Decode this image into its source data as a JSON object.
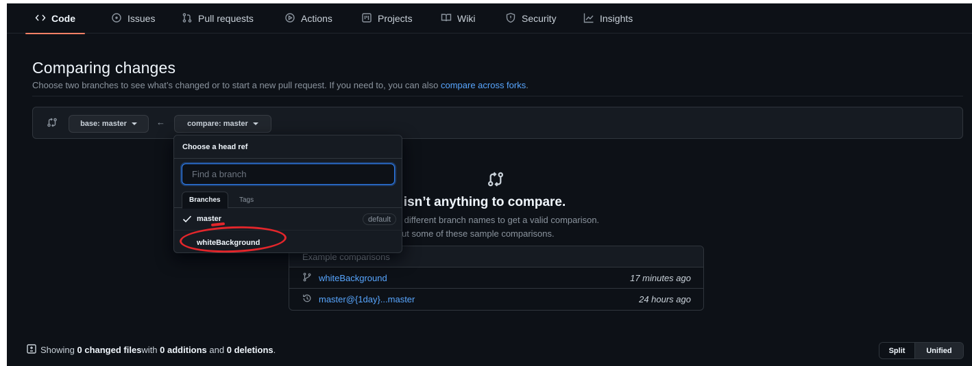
{
  "tabs": [
    {
      "label": "Code",
      "icon": "code-icon"
    },
    {
      "label": "Issues",
      "icon": "issue-icon"
    },
    {
      "label": "Pull requests",
      "icon": "pull-request-icon"
    },
    {
      "label": "Actions",
      "icon": "play-icon"
    },
    {
      "label": "Projects",
      "icon": "project-icon"
    },
    {
      "label": "Wiki",
      "icon": "book-icon"
    },
    {
      "label": "Security",
      "icon": "shield-icon"
    },
    {
      "label": "Insights",
      "icon": "graph-icon"
    }
  ],
  "header": {
    "title": "Comparing changes",
    "subtitle": "Choose two branches to see what’s changed or to start a new pull request. If you need to, you can also ",
    "subtitle_link": "compare across forks",
    "subtitle_end": "."
  },
  "range": {
    "base_label": "base: master",
    "compare_label": "compare: master"
  },
  "dropdown": {
    "title": "Choose a head ref",
    "placeholder": "Find a branch",
    "tabs": [
      "Branches",
      "Tags"
    ],
    "items": [
      {
        "label": "master",
        "selected": true,
        "badge": "default"
      },
      {
        "label": "whiteBackground",
        "selected": false
      }
    ]
  },
  "blankslate": {
    "title": "ere isn’t anything to compare.",
    "line1": "e two different branch names to get a valid comparison.",
    "line2": "eck out some of these sample comparisons."
  },
  "examples": {
    "header": "Example comparisons",
    "rows": [
      {
        "label": "whiteBackground",
        "time": "17 minutes ago",
        "icon": "branch-icon"
      },
      {
        "label": "master@{1day}...master",
        "time": "24 hours ago",
        "icon": "history-icon"
      }
    ]
  },
  "summary": {
    "prefix": "Showing ",
    "changed": "0 changed files",
    "mid1": " with ",
    "additions": "0 additions",
    "mid2": " and ",
    "deletions": "0 deletions",
    "end": "."
  },
  "view_toggle": {
    "split": "Split",
    "unified": "Unified"
  },
  "colors": {
    "background": "#0d1117",
    "accent_link": "#58a6ff",
    "tab_underline": "#f78166",
    "annotation": "#e3262b",
    "focus_ring": "#2f81f7"
  }
}
